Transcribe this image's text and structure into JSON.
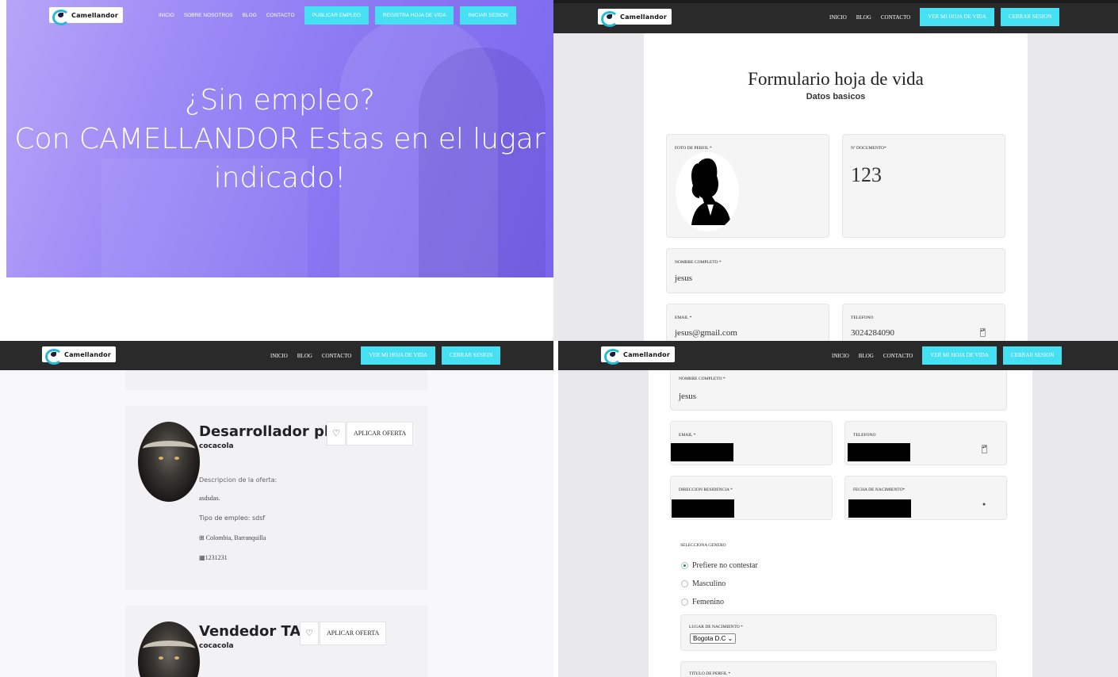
{
  "brand": {
    "name": "Camellandor"
  },
  "hero": {
    "nav_links": [
      "INICIO",
      "SOBRE NOSOTROS",
      "BLOG",
      "CONTACTO"
    ],
    "nav_buttons": [
      "PUBLICAR EMPLEO",
      "REGISTRA HOJA DE VIDA",
      "INICIAR SESION"
    ],
    "headline_lines": [
      "¿Sin empleo?",
      "Con CAMELLANDOR Estas en el lugar",
      "indicado!"
    ]
  },
  "auth_nav": {
    "links": [
      "INICIO",
      "BLOG",
      "CONTACTO"
    ],
    "buttons": [
      "VER MI HOJA DE VIDA",
      "CERRAR SESION"
    ]
  },
  "form": {
    "title": "Formulario hoja de vida",
    "subtitle": "Datos basicos",
    "photo_label": "FOTO DE PERFIL *",
    "doc_label": "Nº DOCUMENTO*",
    "doc_value": "123",
    "name_label": "NOMBRE COMPLETO *",
    "name_value": "jesus",
    "email_label": "EMAIL *",
    "email_value": "jesus@gmail.com",
    "phone_label": "TELEFONO",
    "phone_value": "3024284090",
    "address_label": "DIRECCION RESIDENCIA *",
    "birth_label": "FECHA DE NACIMIENTO*",
    "gender_label": "SELECCIONA GENERO",
    "gender_options": [
      "Prefiere no contestar",
      "Masculino",
      "Femenino"
    ],
    "gender_selected": "Prefiere no contestar",
    "birthplace_label": "LUGAR DE NACIMIENTO *",
    "birthplace_value": "Bogota D.C",
    "profile_title_label": "TITULO DE PERFIL *"
  },
  "jobs": {
    "partial_top_id": "1231231",
    "offer_button": "APLICAR OFERTA",
    "items": [
      {
        "title": "Desarrollador php",
        "company": "cocacola",
        "desc_label": "Descripcion de la oferta:",
        "desc_value": "asdsdas.",
        "type_label": "Tipo de empleo: sdsf",
        "location": "Colombia, Barranquilla",
        "id": "1231231"
      },
      {
        "title": "Vendedor TAT",
        "company": "cocacola"
      }
    ]
  }
}
